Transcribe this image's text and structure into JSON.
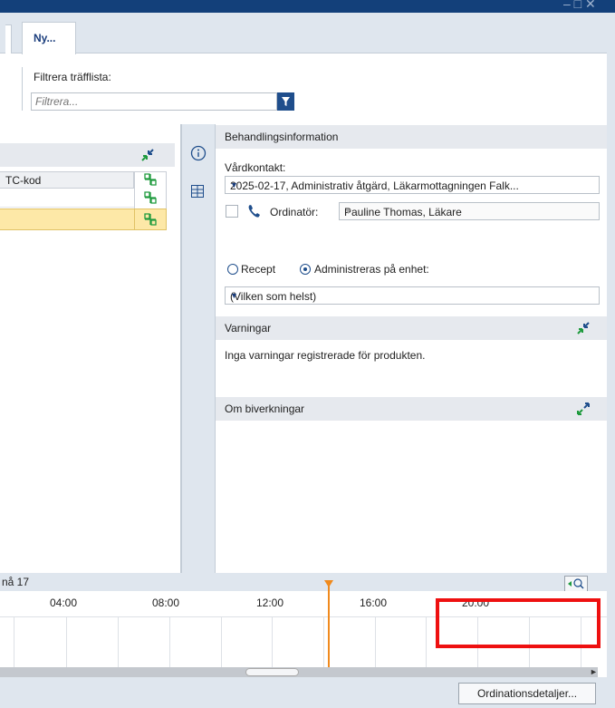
{
  "window": {
    "controls": "– □ ✕"
  },
  "tabs": {
    "active_label": "Ny..."
  },
  "filter": {
    "label": "Filtrera träfflista:",
    "placeholder": "Filtrera..."
  },
  "left_panel": {
    "atc_header": "TC-kod"
  },
  "treatment": {
    "header": "Behandlingsinformation",
    "contact_label": "Vårdkontakt:",
    "contact_value": "2025-02-17, Administrativ åtgärd, Läkarmottagningen Falk...",
    "prescriber_label": "Ordinatör:",
    "prescriber_value": "Pauline Thomas, Läkare",
    "radio_recept": "Recept",
    "radio_admin": "Administreras på enhet:",
    "unit_value": "(Vilken som helst)"
  },
  "warnings": {
    "header": "Varningar",
    "text": "Inga varningar registrerade för produkten."
  },
  "side_effects": {
    "header": "Om biverkningar"
  },
  "timeline": {
    "label": "nå 17",
    "ticks": [
      "04:00",
      "08:00",
      "12:00",
      "16:00",
      "20:00"
    ]
  },
  "footer": {
    "details_button": "Ordinationsdetaljer..."
  },
  "colors": {
    "accent": "#1f4e8c",
    "now": "#f08a1d",
    "highlight": "#ee1010",
    "row_selected": "#fde8a7"
  },
  "icons": [
    "filter-icon",
    "collapse-icon",
    "expand-icon",
    "info-icon",
    "grid-icon",
    "phone-icon",
    "pill-icon",
    "zoom-icon"
  ]
}
